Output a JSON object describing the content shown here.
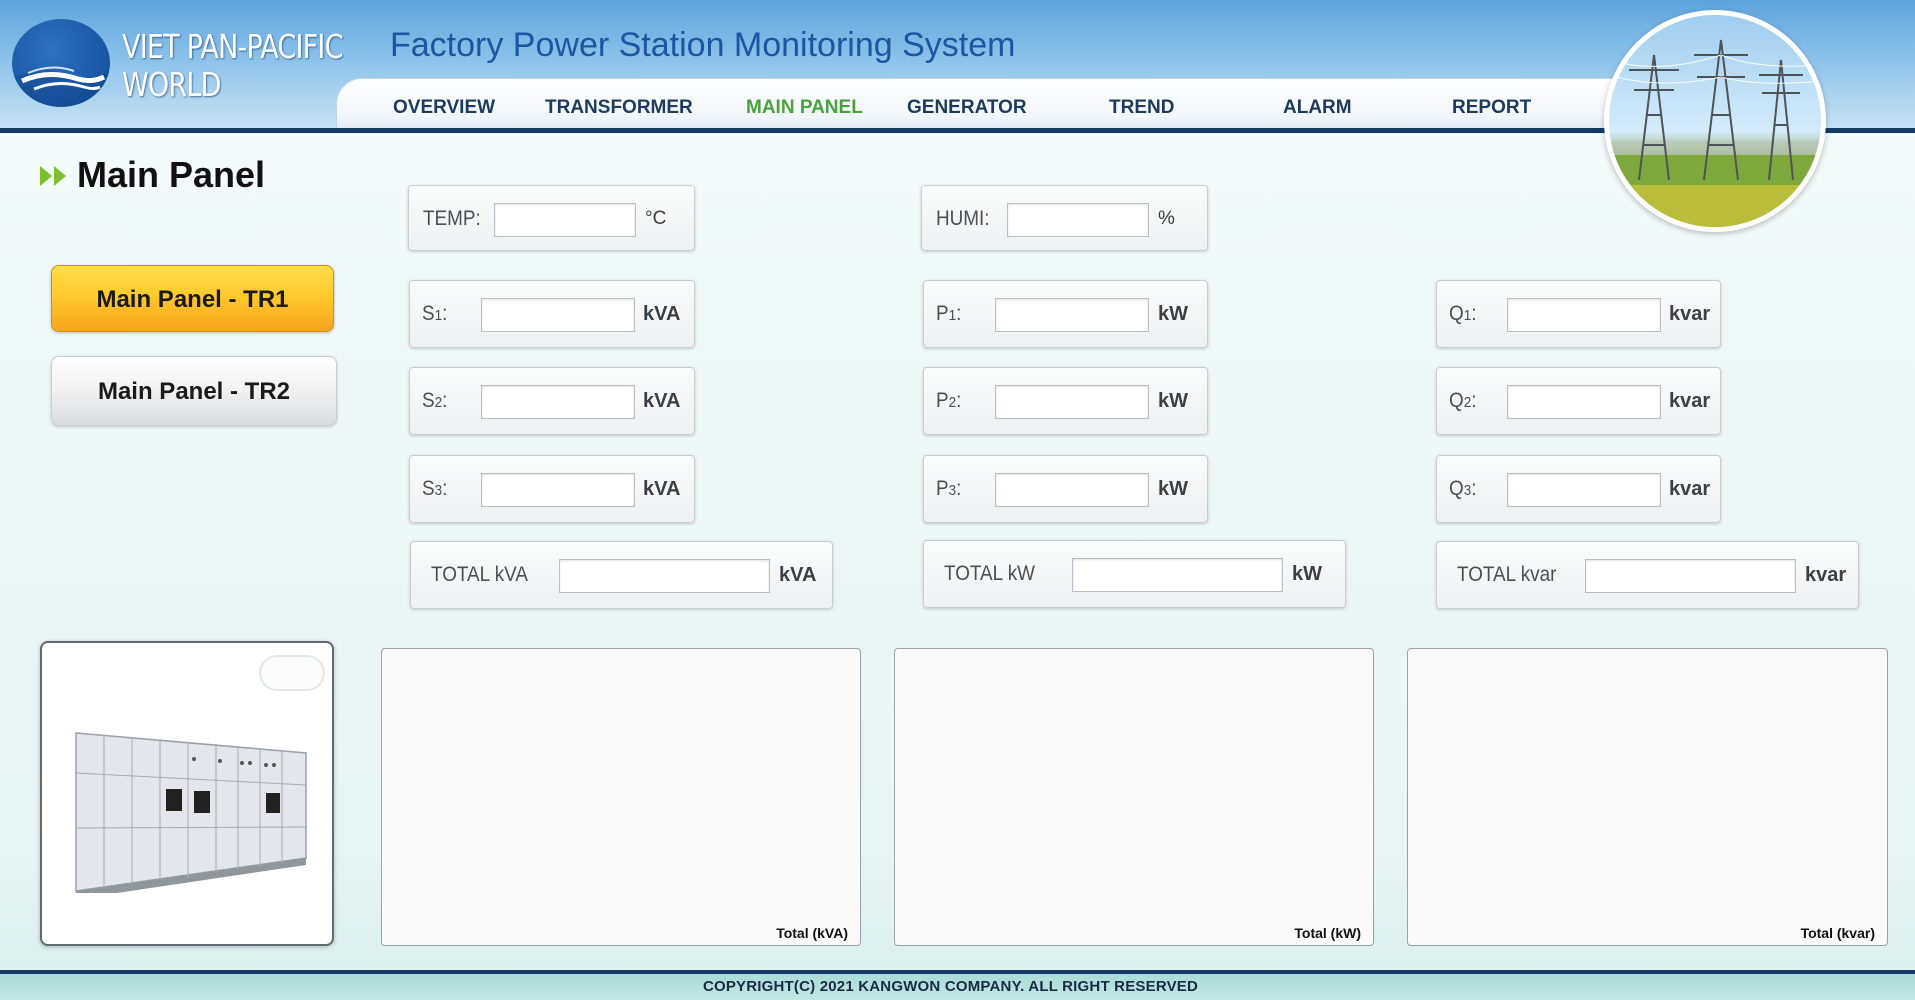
{
  "brand": {
    "logo_line1": "VIET PAN-PACIFIC",
    "logo_line2": "WORLD",
    "app_title": "Factory Power Station Monitoring System"
  },
  "nav": {
    "items": [
      {
        "label": "OVERVIEW",
        "active": false
      },
      {
        "label": "TRANSFORMER",
        "active": false
      },
      {
        "label": "MAIN PANEL",
        "active": true
      },
      {
        "label": "GENERATOR",
        "active": false
      },
      {
        "label": "TREND",
        "active": false
      },
      {
        "label": "ALARM",
        "active": false
      },
      {
        "label": "REPORT",
        "active": false
      }
    ],
    "active_color": "#4aa23c"
  },
  "page": {
    "title": "Main Panel"
  },
  "sidebar": {
    "buttons": [
      {
        "label": "Main Panel - TR1",
        "selected": true
      },
      {
        "label": "Main Panel - TR2",
        "selected": false
      }
    ]
  },
  "environment": {
    "temp": {
      "label": "TEMP:",
      "value": "",
      "unit": "°C"
    },
    "humi": {
      "label": "HUMI:",
      "value": "",
      "unit": "%"
    }
  },
  "readings": {
    "s1": {
      "label": "S",
      "sub": "1",
      "colon": ":",
      "value": "",
      "unit": "kVA"
    },
    "s2": {
      "label": "S",
      "sub": "2",
      "colon": ":",
      "value": "",
      "unit": "kVA"
    },
    "s3": {
      "label": "S",
      "sub": "3",
      "colon": ":",
      "value": "",
      "unit": "kVA"
    },
    "p1": {
      "label": "P",
      "sub": "1",
      "colon": ":",
      "value": "",
      "unit": "kW"
    },
    "p2": {
      "label": "P",
      "sub": "2",
      "colon": ":",
      "value": "",
      "unit": "kW"
    },
    "p3": {
      "label": "P",
      "sub": "3",
      "colon": ":",
      "value": "",
      "unit": "kW"
    },
    "q1": {
      "label": "Q",
      "sub": "1",
      "colon": ":",
      "value": "",
      "unit": "kvar"
    },
    "q2": {
      "label": "Q",
      "sub": "2",
      "colon": ":",
      "value": "",
      "unit": "kvar"
    },
    "q3": {
      "label": "Q",
      "sub": "3",
      "colon": ":",
      "value": "",
      "unit": "kvar"
    }
  },
  "totals": {
    "kva": {
      "label": "TOTAL kVA",
      "value": "",
      "unit": "kVA"
    },
    "kw": {
      "label": "TOTAL kW",
      "value": "",
      "unit": "kW"
    },
    "kvar": {
      "label": "TOTAL kvar",
      "value": "",
      "unit": "kvar"
    }
  },
  "charts": {
    "kva_caption": "Total (kVA)",
    "kw_caption": "Total (kW)",
    "kvar_caption": "Total (kvar)"
  },
  "footer": {
    "copyright": "COPYRIGHT(C) 2021 KANGWON COMPANY. ALL RIGHT RESERVED"
  },
  "icons": {
    "logo": "wave-logo-icon",
    "title_arrow": "double-chevron-right-icon",
    "header_photo": "power-tower-photo",
    "panel_photo": "switchgear-panel-image"
  }
}
